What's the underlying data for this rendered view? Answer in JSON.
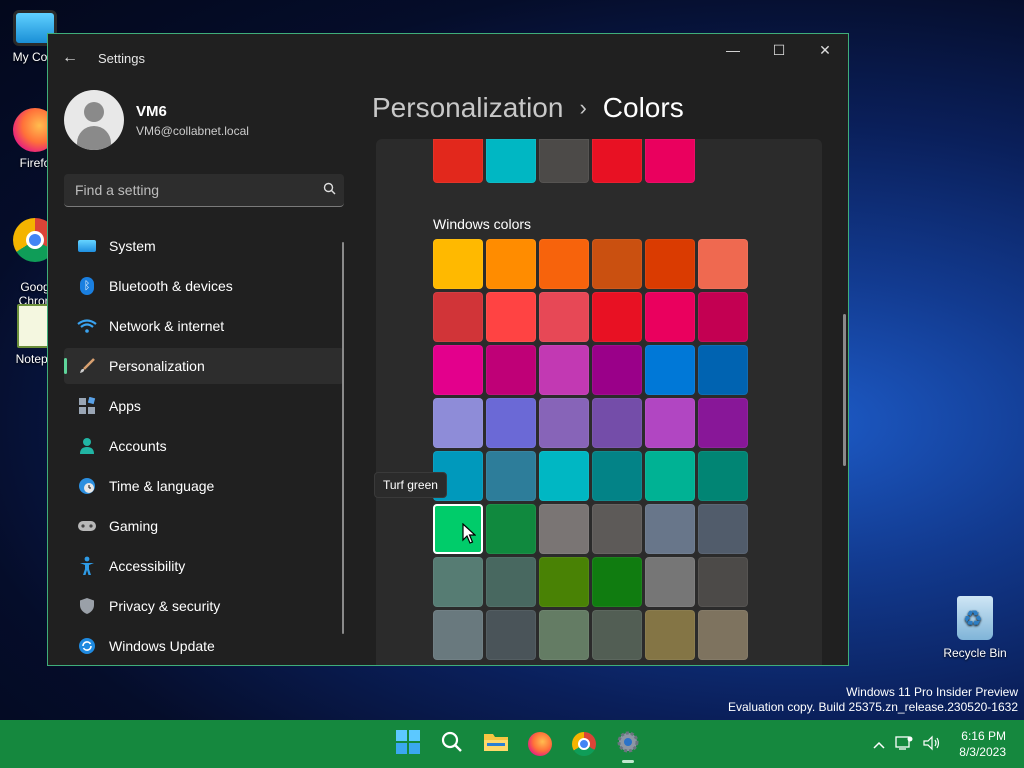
{
  "desktop": {
    "icons": [
      {
        "label": "My Com",
        "icon": "monitor-icon"
      },
      {
        "label": "Firefo",
        "icon": "firefox-icon"
      },
      {
        "label": "Goog\nChron",
        "icon": "chrome-icon"
      },
      {
        "label": "Notepa",
        "icon": "notepad-icon"
      }
    ],
    "recycle_bin": "Recycle Bin",
    "watermark_line1": "Windows 11 Pro Insider Preview",
    "watermark_line2": "Evaluation copy. Build 25375.zn_release.230520-1632"
  },
  "window": {
    "title": "Settings",
    "controls": {
      "minimize": "—",
      "maximize": "☐",
      "close": "✕"
    }
  },
  "profile": {
    "name": "VM6",
    "email": "VM6@collabnet.local"
  },
  "search": {
    "placeholder": "Find a setting"
  },
  "nav": {
    "items": [
      {
        "label": "System",
        "icon": "system-icon"
      },
      {
        "label": "Bluetooth & devices",
        "icon": "bluetooth-icon"
      },
      {
        "label": "Network & internet",
        "icon": "wifi-icon"
      },
      {
        "label": "Personalization",
        "icon": "brush-icon",
        "active": true
      },
      {
        "label": "Apps",
        "icon": "apps-icon"
      },
      {
        "label": "Accounts",
        "icon": "accounts-icon"
      },
      {
        "label": "Time & language",
        "icon": "globe-icon"
      },
      {
        "label": "Gaming",
        "icon": "gamepad-icon"
      },
      {
        "label": "Accessibility",
        "icon": "accessibility-icon"
      },
      {
        "label": "Privacy & security",
        "icon": "shield-icon"
      },
      {
        "label": "Windows Update",
        "icon": "update-icon"
      }
    ]
  },
  "breadcrumb": {
    "parent": "Personalization",
    "separator": "›",
    "current": "Colors"
  },
  "colors": {
    "recent": [
      "#e2281c",
      "#00b7c3",
      "#4c4a48",
      "#e81123",
      "#ea005e"
    ],
    "windows_colors_label": "Windows colors",
    "windows_colors": [
      "#ffb900",
      "#ff8c00",
      "#f7630c",
      "#ca5010",
      "#da3b01",
      "#ef6950",
      "#d13438",
      "#ff4343",
      "#e74856",
      "#e81123",
      "#ea005e",
      "#c30052",
      "#e3008c",
      "#bf0077",
      "#c239b3",
      "#9a0089",
      "#0078d7",
      "#0063b1",
      "#8e8cd8",
      "#6b69d6",
      "#8764b8",
      "#744da9",
      "#b146c2",
      "#881798",
      "#0099bc",
      "#2d7d9a",
      "#00b7c3",
      "#038387",
      "#00b294",
      "#018574",
      "#00cc6a",
      "#10893e",
      "#7a7574",
      "#5d5a58",
      "#68768a",
      "#515c6b",
      "#567c73",
      "#486860",
      "#498205",
      "#107c10",
      "#767676",
      "#4c4a48",
      "#69797e",
      "#4a5459",
      "#647c64",
      "#525e54",
      "#847545",
      "#7e735f"
    ],
    "selected_index": 30,
    "tooltip": "Turf green"
  },
  "taskbar": {
    "apps": [
      {
        "name": "start",
        "icon": "windows-logo-icon"
      },
      {
        "name": "search",
        "icon": "search-icon"
      },
      {
        "name": "file-explorer",
        "icon": "folder-icon"
      },
      {
        "name": "firefox",
        "icon": "firefox-icon"
      },
      {
        "name": "chrome",
        "icon": "chrome-icon"
      },
      {
        "name": "settings",
        "icon": "gear-icon",
        "active": true
      }
    ],
    "tray_chevron": "^",
    "time": "6:16 PM",
    "date": "8/3/2023"
  },
  "theme": {
    "accent": "#15883e",
    "window_border": "#3fae7a",
    "nav_indicator": "#5ed49a"
  }
}
